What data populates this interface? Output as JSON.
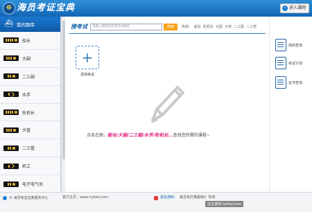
{
  "header": {
    "logo_glyph": "☸",
    "title": "海员考证宝典",
    "enter_button": "进入课网"
  },
  "sidebar": {
    "heading": "我的题库",
    "items": [
      {
        "label": "船长",
        "bars": 4
      },
      {
        "label": "大副",
        "bars": 3
      },
      {
        "label": "二三副",
        "bars": 2
      },
      {
        "label": "水手",
        "bars": 1
      },
      {
        "label": "轮机长",
        "bars": 4
      },
      {
        "label": "大管",
        "bars": 3
      },
      {
        "label": "二三管",
        "bars": 2
      },
      {
        "label": "机工",
        "bars": 1
      },
      {
        "label": "电子电气员",
        "bars": 2
      }
    ]
  },
  "main": {
    "search_title": "搜考试",
    "search_placeholder": "请输入课程名称或考试搜索",
    "search_button": "搜索",
    "hot_label": "热搜：",
    "hot_tags": [
      "船长",
      "轮机长",
      "大副",
      "大管",
      "二三副",
      "二三管"
    ],
    "add_exam_label": "添加考试",
    "prompt_prefix": "点击左侧，",
    "prompt_highlight": "船长/大副/二三副/水手/轮机长...",
    "prompt_suffix": "查找您所需的课程~"
  },
  "right_panel": {
    "items": [
      {
        "label": "成绩查询",
        "icon": "score-icon"
      },
      {
        "label": "考试计划",
        "icon": "plan-icon"
      },
      {
        "label": "证书查询",
        "icon": "certificate-icon"
      }
    ]
  },
  "footer": {
    "service": "© 海员考证宝典服务中心",
    "site": "官方主页：www.hykbd.com",
    "notice_label": "紧急通知：",
    "notice_text": "最近有打着超级ti",
    "notice_more": "热线",
    "watermark": "宝宝游戏·hykbd.com"
  },
  "colors": {
    "header": "#1a78cf",
    "accent": "#f5a21b",
    "highlight": "#e0197d"
  }
}
